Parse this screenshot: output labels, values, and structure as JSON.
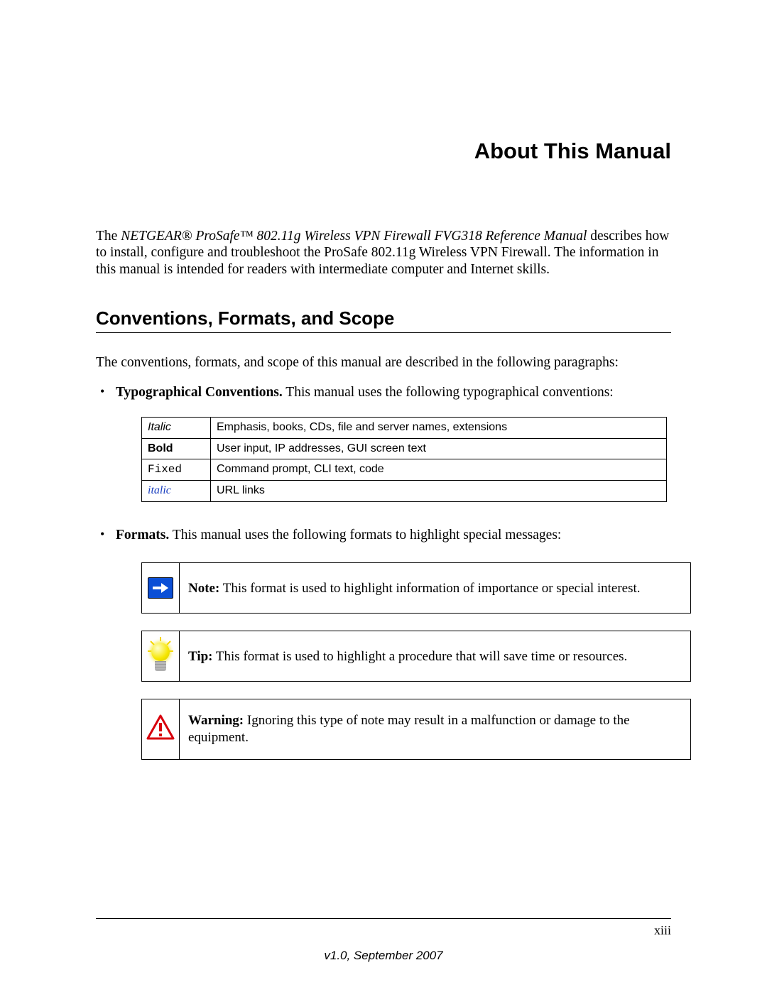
{
  "chapter_title": "About This Manual",
  "intro": {
    "prefix": "The ",
    "product_italic": "NETGEAR® ProSafe™ 802.11g Wireless VPN Firewall FVG318 Reference Manual",
    "suffix": " describes how to install, configure and troubleshoot the ProSafe 802.11g Wireless VPN Firewall. The information in this manual is intended for readers with intermediate computer and Internet skills."
  },
  "section_heading": "Conventions, Formats, and Scope",
  "section_lead": "The conventions, formats, and scope of this manual are described in the following paragraphs:",
  "bullet_typo": {
    "label": "Typographical Conventions.",
    "text": " This manual uses the following typographical conventions:"
  },
  "typo_table": [
    {
      "style": "italic",
      "label": "Italic",
      "desc": "Emphasis, books, CDs, file and server names, extensions"
    },
    {
      "style": "bold",
      "label": "Bold",
      "desc": "User input, IP addresses, GUI screen text"
    },
    {
      "style": "fixed",
      "label": "Fixed",
      "desc": "Command prompt, CLI text, code"
    },
    {
      "style": "link",
      "label": "italic",
      "desc": "URL links"
    }
  ],
  "bullet_formats": {
    "label": "Formats.",
    "text": " This manual uses the following formats to highlight special messages:"
  },
  "callouts": {
    "note": {
      "label": "Note:",
      "text": " This format is used to highlight information of importance or special interest."
    },
    "tip": {
      "label": "Tip:",
      "text": " This format is used to highlight a procedure that will save time or resources."
    },
    "warning": {
      "label": "Warning:",
      "text": " Ignoring this type of note may result in a malfunction or damage to the equipment."
    }
  },
  "footer": {
    "page": "xiii",
    "version": "v1.0, September 2007"
  }
}
